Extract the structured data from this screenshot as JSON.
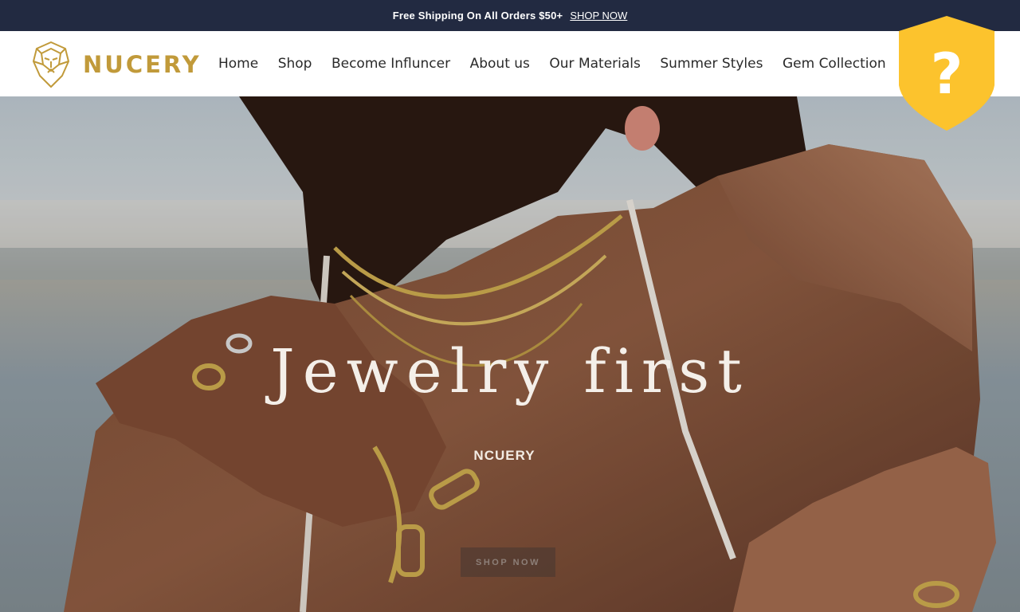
{
  "announcement": {
    "message": "Free Shipping On All Orders $50+",
    "link_label": "SHOP NOW"
  },
  "brand": {
    "name": "NUCERY",
    "logo_icon": "lion-head-icon",
    "color": "#c19a3a"
  },
  "nav": {
    "items": [
      {
        "label": "Home"
      },
      {
        "label": "Shop"
      },
      {
        "label": "Become Influncer"
      },
      {
        "label": "About us"
      },
      {
        "label": "Our Materials"
      },
      {
        "label": "Summer Styles"
      },
      {
        "label": "Gem Collection"
      }
    ]
  },
  "help_badge": {
    "icon": "question-shield-icon",
    "glyph": "?",
    "color": "#fcc32d"
  },
  "hero": {
    "title": "Jewelry first",
    "subtitle": "NCUERY",
    "button_label": "SHOP NOW"
  },
  "colors": {
    "announcement_bg": "#222a41",
    "header_bg": "#ffffff",
    "nav_text": "#2a2a2a"
  }
}
